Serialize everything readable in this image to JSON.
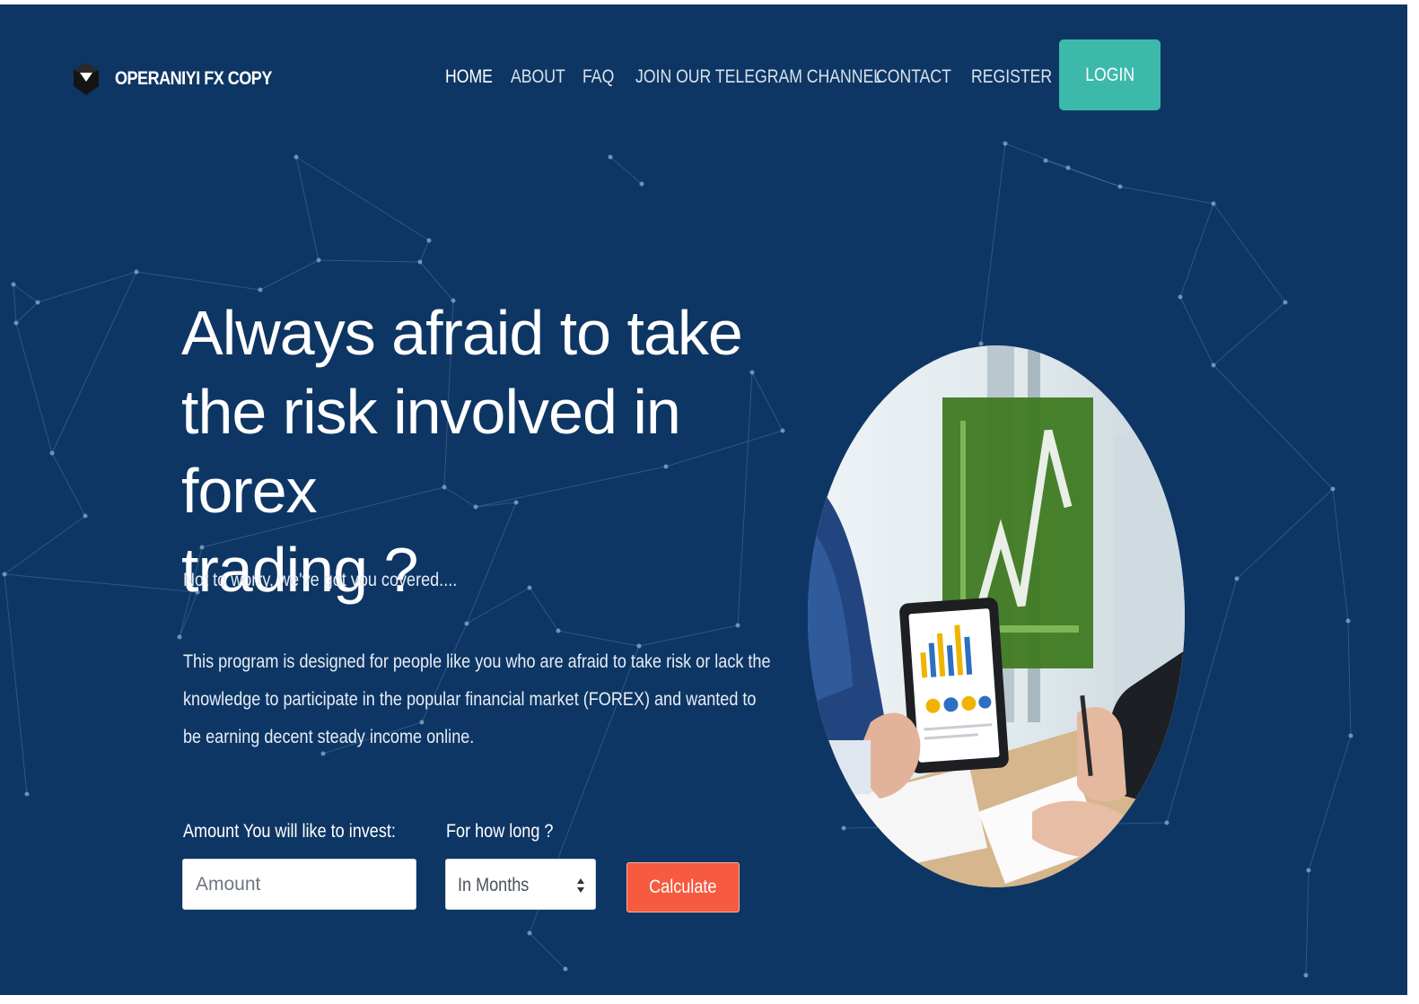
{
  "brand": {
    "name": "OPERANIYI FX COPY",
    "icon": "cube-logo-icon"
  },
  "nav": {
    "items": [
      {
        "label": "HOME",
        "active": true
      },
      {
        "label": "ABOUT",
        "active": false
      },
      {
        "label": "FAQ",
        "active": false
      },
      {
        "label": "JOIN OUR TELEGRAM CHANNEL",
        "active": false
      },
      {
        "label": "CONTACT",
        "active": false
      },
      {
        "label": "REGISTER",
        "active": false
      }
    ],
    "login_label": "LOGIN"
  },
  "hero": {
    "headline": {
      "line1": "Always afraid to take",
      "line2": "the risk involved in forex",
      "line3": "trading ?"
    },
    "subheadline": "Not to worry, we've got you covered....",
    "description": "This program is designed for people like you who are afraid to take risk or lack the knowledge to participate in the popular financial market (FOREX) and wanted to be earning decent steady income online."
  },
  "calculator": {
    "amount_label": "Amount You will like to invest:",
    "amount_placeholder": "Amount",
    "amount_value": "",
    "duration_label": "For how long ?",
    "duration_selected": "In Months",
    "submit_label": "Calculate"
  },
  "colors": {
    "background": "#0e3664",
    "login_button": "#3db9ac",
    "calculate_button": "#f65a3f",
    "text": "#ffffff"
  }
}
